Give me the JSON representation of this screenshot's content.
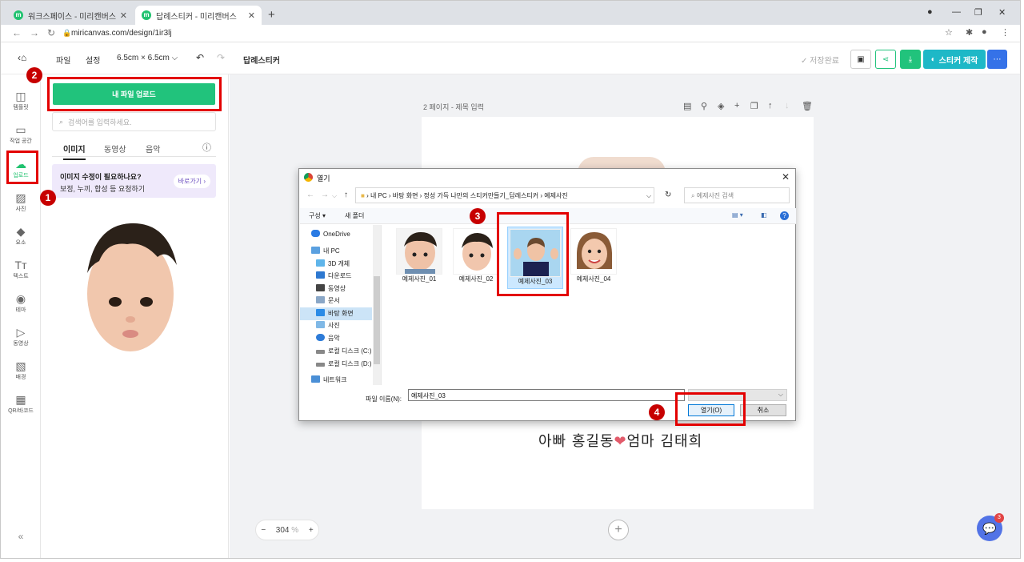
{
  "browser": {
    "tabs": [
      {
        "title": "워크스페이스 - 미리캔버스",
        "active": false
      },
      {
        "title": "답례스티커 - 미리캔버스",
        "active": true
      }
    ],
    "url": "miricanvas.com/design/1ir3lj"
  },
  "header": {
    "file": "파일",
    "settings": "설정",
    "size": "6.5cm × 6.5cm",
    "doc_title": "답례스티커",
    "saved": "저장완료",
    "make_sticker": "스티커 제작"
  },
  "sidebar": {
    "items": [
      {
        "label": "템플릿",
        "icon": "template-icon"
      },
      {
        "label": "작업 공간",
        "icon": "workspace-icon"
      },
      {
        "label": "업로드",
        "icon": "upload-icon"
      },
      {
        "label": "사진",
        "icon": "photo-icon"
      },
      {
        "label": "요소",
        "icon": "elements-icon"
      },
      {
        "label": "텍스트",
        "icon": "text-icon"
      },
      {
        "label": "테마",
        "icon": "theme-icon"
      },
      {
        "label": "동영상",
        "icon": "video-icon"
      },
      {
        "label": "배경",
        "icon": "background-icon"
      },
      {
        "label": "QR/바코드",
        "icon": "qr-icon"
      }
    ],
    "collapse": "«"
  },
  "panel": {
    "upload_button": "내 파일 업로드",
    "search_placeholder": "검색어를 입력하세요.",
    "tabs": [
      "이미지",
      "동영상",
      "음악"
    ],
    "promo_title": "이미지 수정이 필요하나요?",
    "promo_desc": "보정, 누끼, 합성 등 요청하기",
    "promo_button": "바로가기"
  },
  "canvas": {
    "page_label": "2 페이지 - 제목 입력",
    "zoom_value": "304",
    "zoom_unit": "%",
    "sticker_text_left": "아빠 홍길동",
    "sticker_text_right": "엄마 김태희"
  },
  "chat_badge": "3",
  "dialog": {
    "title": "열기",
    "path": [
      "내 PC",
      "바탕 화면",
      "정성 가득 나만의 스티커만들기_답례스티커",
      "예제사진"
    ],
    "search_placeholder": "예제사진 검색",
    "organize": "구성 ▾",
    "new_folder": "새 폴더",
    "tree": [
      "OneDrive",
      "내 PC",
      "3D 개체",
      "다운로드",
      "동영상",
      "문서",
      "바탕 화면",
      "사진",
      "음악",
      "로컬 디스크 (C:)",
      "로컬 디스크 (D:)",
      "네트워크"
    ],
    "files": [
      "예제사진_01",
      "예제사진_02",
      "예제사진_03",
      "예제사진_04"
    ],
    "selected_file": "예제사진_03",
    "filename_label": "파일 이름(N):",
    "filename_value": "예제사진_03",
    "open_button": "열기(O)",
    "cancel_button": "취소"
  },
  "annotations": [
    "1",
    "2",
    "3",
    "4"
  ],
  "colors": {
    "accent": "#21c37c",
    "annotation": "#e30000",
    "chat": "#5273e6",
    "promo": "#efe9fb"
  }
}
